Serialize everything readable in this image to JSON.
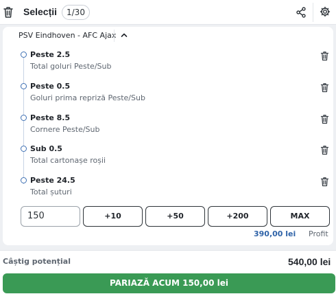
{
  "header": {
    "title": "Selecții",
    "count": "1/30",
    "icons": [
      "trash-icon",
      "share-icon",
      "gear-icon"
    ]
  },
  "match": {
    "name": "PSV Eindhoven - AFC Ajax",
    "collapse_icon": "chevron-up-icon"
  },
  "selections": [
    {
      "pick": "Peste 2.5",
      "market": "Total goluri Peste/Sub"
    },
    {
      "pick": "Peste 0.5",
      "market": "Goluri prima repriză Peste/Sub"
    },
    {
      "pick": "Peste 8.5",
      "market": "Cornere Peste/Sub"
    },
    {
      "pick": "Sub 0.5",
      "market": "Total cartonașe roșii"
    },
    {
      "pick": "Peste 24.5",
      "market": "Total șuturi"
    }
  ],
  "stake": {
    "value": "150",
    "quick_buttons": [
      "+10",
      "+50",
      "+200",
      "MAX"
    ]
  },
  "profit": {
    "value": "390,00 lei",
    "label": "Profit"
  },
  "footer": {
    "potential_label": "Câștig potențial",
    "potential_value": "540,00 lei",
    "bet_button": "PARIAZĂ ACUM 150,00 lei"
  },
  "colors": {
    "accent_blue": "#2f63a8",
    "bet_green": "#3a9a55",
    "timeline": "#c7d3e4"
  }
}
